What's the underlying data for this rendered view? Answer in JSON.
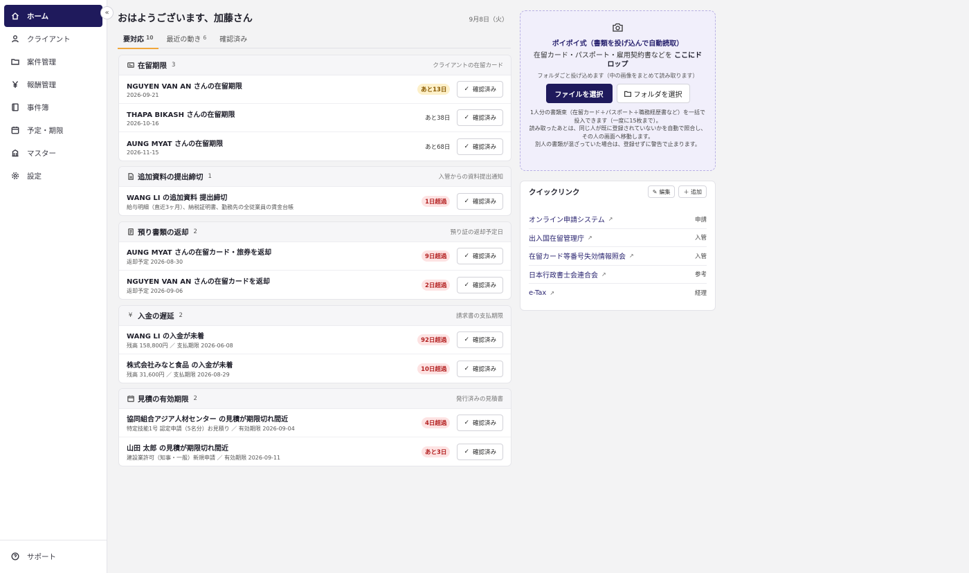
{
  "sidebar": {
    "items": [
      {
        "label": "ホーム",
        "icon": "home-icon"
      },
      {
        "label": "クライアント",
        "icon": "user-icon"
      },
      {
        "label": "案件管理",
        "icon": "folder-icon"
      },
      {
        "label": "報酬管理",
        "icon": "yen-icon"
      },
      {
        "label": "事件簿",
        "icon": "book-icon"
      },
      {
        "label": "予定・期限",
        "icon": "calendar-icon"
      },
      {
        "label": "マスター",
        "icon": "database-icon"
      },
      {
        "label": "設定",
        "icon": "gear-icon"
      }
    ],
    "support_label": "サポート",
    "collapse_glyph": "«"
  },
  "header": {
    "greeting": "おはようございます、加藤さん",
    "date": "9月8日（火）"
  },
  "tabs": [
    {
      "label": "要対応",
      "count": "10"
    },
    {
      "label": "最近の動き",
      "count": "6"
    },
    {
      "label": "確認済み",
      "count": ""
    }
  ],
  "confirm_label": "確認済み",
  "sections": [
    {
      "title": "在留期限",
      "count": "3",
      "sub": "クライアントの在留カード",
      "rows": [
        {
          "title": "NGUYEN VAN AN さんの在留期限",
          "sub": "2026-09-21",
          "badge": "あと13日"
        },
        {
          "title": "THAPA BIKASH さんの在留期限",
          "sub": "2026-10-16",
          "badge": "あと38日"
        },
        {
          "title": "AUNG MYAT さんの在留期限",
          "sub": "2026-11-15",
          "badge": "あと68日"
        }
      ]
    },
    {
      "title": "追加資料の提出締切",
      "count": "1",
      "sub": "入管からの資料提出通知",
      "rows": [
        {
          "title": "WANG LI の追加資料 提出締切",
          "sub": "給与明細（直近3ヶ月）、納税証明書、勤務先の全従業員の賃金台帳",
          "badge": "1日超過"
        }
      ]
    },
    {
      "title": "預り書類の返却",
      "count": "2",
      "sub": "預り証の返却予定日",
      "rows": [
        {
          "title": "AUNG MYAT さんの在留カード・旅券を返却",
          "sub": "返却予定 2026-08-30",
          "badge": "9日超過"
        },
        {
          "title": "NGUYEN VAN AN さんの在留カードを返却",
          "sub": "返却予定 2026-09-06",
          "badge": "2日超過"
        }
      ]
    },
    {
      "title": "入金の遅延",
      "count": "2",
      "sub": "請求書の支払期限",
      "rows": [
        {
          "title": "WANG LI の入金が未着",
          "sub": "残高 158,800円 ／ 支払期限 2026-06-08",
          "badge": "92日超過"
        },
        {
          "title": "株式会社みなと食品 の入金が未着",
          "sub": "残高 31,600円 ／ 支払期限 2026-08-29",
          "badge": "10日超過"
        }
      ]
    },
    {
      "title": "見積の有効期限",
      "count": "2",
      "sub": "発行済みの見積書",
      "rows": [
        {
          "title": "協同組合アジア人材センター の見積が期限切れ間近",
          "sub": "特定技能1号 認定申請（5名分）お見積り ／ 有効期限 2026-09-04",
          "badge": "4日超過"
        },
        {
          "title": "山田 太郎 の見積が期限切れ間近",
          "sub": "建設業許可（知事・一般）新規申請 ／ 有効期限 2026-09-11",
          "badge": "あと3日"
        }
      ]
    }
  ],
  "dropzone": {
    "title": "ポイポイ式（書類を投げ込んで自動読取）",
    "line_prefix": "在留カード・パスポート・雇用契約書などを",
    "line_bold": "ここにドロップ",
    "note": "フォルダごと投げ込めます（中の画像をまとめて読み取ります）",
    "file_button": "ファイルを選択",
    "folder_button": "フォルダを選択",
    "help1": "1人分の書類束（在留カード＋パスポート＋職務経歴書など）を一括で投入できます（一度に15枚まで）。",
    "help2": "読み取ったあとは、同じ人が既に登録されていないかを自動で照合し、その人の画面へ移動します。",
    "help3": "別人の書類が混ざっていた場合は、登録せずに警告で止まります。"
  },
  "quicklinks": {
    "title": "クイックリンク",
    "edit_label": "編集",
    "add_label": "＋ 追加",
    "items": [
      {
        "label": "オンライン申請システム",
        "tag": "申請"
      },
      {
        "label": "出入国在留管理庁",
        "tag": "入管"
      },
      {
        "label": "在留カード等番号失効情報照会",
        "tag": "入管"
      },
      {
        "label": "日本行政書士会連合会",
        "tag": "参考"
      },
      {
        "label": "e-Tax",
        "tag": "経理"
      }
    ]
  },
  "colors": {
    "primary": "#1f1a5c",
    "accent_tab": "#f0a63b",
    "badge_red_bg": "#fde3e3",
    "badge_red_text": "#b42222",
    "badge_yellow_bg": "#fdf0c9",
    "dropzone_bg": "#f1effb"
  }
}
